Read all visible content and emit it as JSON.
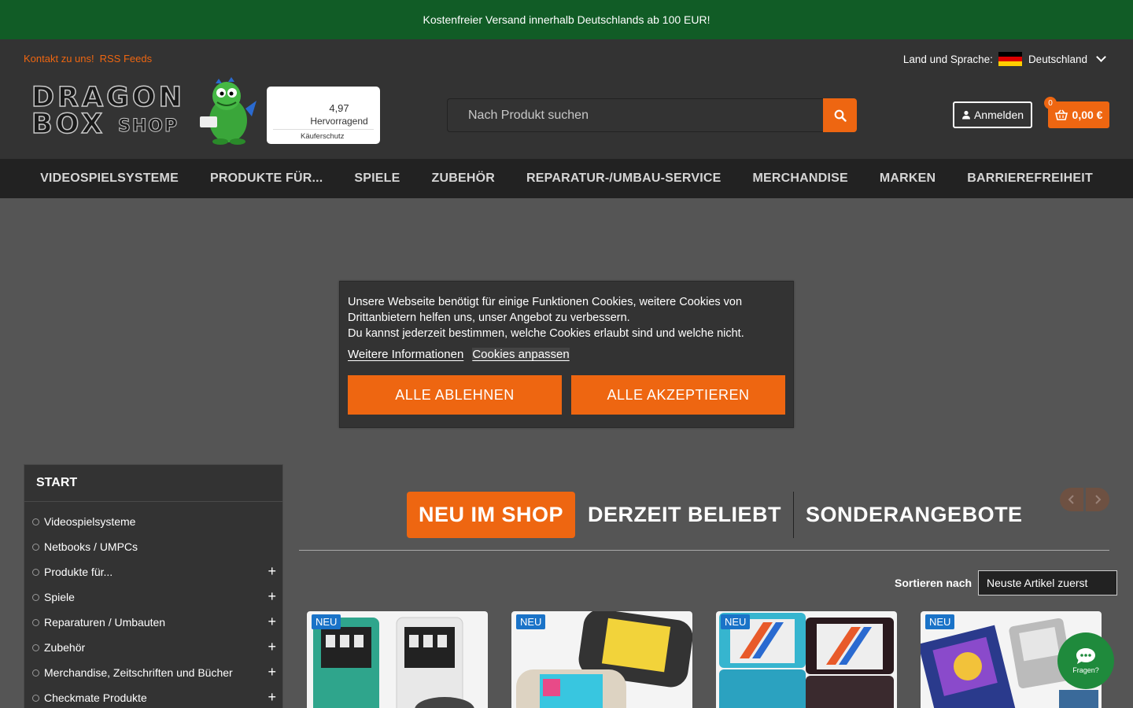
{
  "topbar": {
    "shipping_text": "Kostenfreier Versand innerhalb Deutschlands ab 100 EUR!"
  },
  "header": {
    "links": [
      "Kontakt zu uns!",
      "RSS Feeds"
    ],
    "lang_label": "Land und Sprache:",
    "lang_value": "Deutschland",
    "logo_text": {
      "line1": "DRAGON",
      "line2": "BOX",
      "line3": "SHOP"
    },
    "trust": {
      "score": "4,97",
      "grade": "Hervorragend",
      "protection": "Käuferschutz"
    },
    "search_placeholder": "Nach Produkt suchen",
    "login_label": "Anmelden",
    "cart_amount": "0,00 €",
    "cart_count": "0"
  },
  "nav": {
    "items": [
      "VIDEOSPIELSYSTEME",
      "PRODUKTE FÜR...",
      "SPIELE",
      "ZUBEHÖR",
      "REPARATUR-/UMBAU-SERVICE",
      "MERCHANDISE",
      "MARKEN",
      "BARRIEREFREIHEIT"
    ]
  },
  "cookie": {
    "text1": "Unsere Webseite benötigt für einige Funktionen Cookies, weitere Cookies von Drittanbietern helfen uns, unser Angebot zu verbessern.",
    "text2": "Du kannst jederzeit bestimmen, welche Cookies erlaubt sind und welche nicht.",
    "link_info": "Weitere Informationen",
    "link_customize": "Cookies anpassen",
    "btn_reject": "ALLE ABLEHNEN",
    "btn_accept": "ALLE AKZEPTIEREN"
  },
  "sidebar": {
    "title": "START",
    "items": [
      {
        "label": "Videospielsysteme",
        "expandable": false
      },
      {
        "label": "Netbooks / UMPCs",
        "expandable": false
      },
      {
        "label": "Produkte für...",
        "expandable": true
      },
      {
        "label": "Spiele",
        "expandable": true
      },
      {
        "label": "Reparaturen / Umbauten",
        "expandable": true
      },
      {
        "label": "Zubehör",
        "expandable": true
      },
      {
        "label": "Merchandise, Zeitschriften und Bücher",
        "expandable": true
      },
      {
        "label": "Checkmate Produkte",
        "expandable": true
      }
    ],
    "plus_symbol": "+"
  },
  "tabs": {
    "active": "NEU IM SHOP",
    "tab2": "DERZEIT BELIEBT",
    "tab3": "SONDERANGEBOTE"
  },
  "sort": {
    "label": "Sortieren nach",
    "value": "Neuste Artikel zuerst"
  },
  "products": [
    {
      "badge": "NEU"
    },
    {
      "badge": "NEU"
    },
    {
      "badge": "NEU"
    },
    {
      "badge": "NEU"
    }
  ],
  "chat": {
    "label": "Fragen?"
  },
  "colors": {
    "accent": "#ee6611",
    "topbar": "#115c26",
    "header": "#333333",
    "nav": "#222222",
    "badge": "#1a73c8",
    "chat": "#1f8a3c"
  }
}
